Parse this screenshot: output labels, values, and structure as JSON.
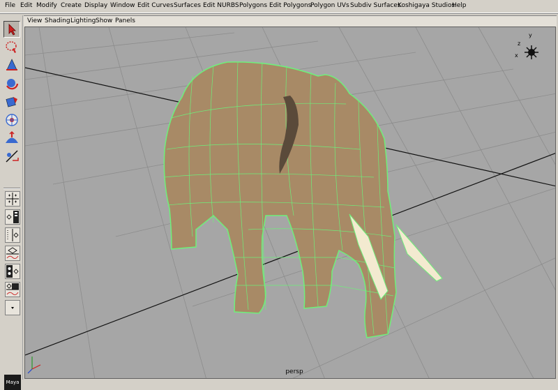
{
  "menubar": {
    "items": [
      {
        "label": "File"
      },
      {
        "label": "Edit"
      },
      {
        "label": "Modify"
      },
      {
        "label": "Create"
      },
      {
        "label": "Display"
      },
      {
        "label": "Window"
      },
      {
        "label": "Edit Curves"
      },
      {
        "label": "Surfaces"
      },
      {
        "label": "Edit NURBS"
      },
      {
        "label": "Polygons"
      },
      {
        "label": "Edit Polygons"
      },
      {
        "label": "Polygon UVs"
      },
      {
        "label": "Subdiv Surfaces"
      },
      {
        "label": "Koshigaya Studios"
      },
      {
        "label": "Help"
      }
    ]
  },
  "panel_menu": {
    "items": [
      {
        "label": "View"
      },
      {
        "label": "Shading"
      },
      {
        "label": "Lighting"
      },
      {
        "label": "Show"
      },
      {
        "label": "Panels"
      }
    ]
  },
  "viewport": {
    "camera_label": "persp",
    "axis": {
      "y": "y",
      "z": "z",
      "x": "x"
    },
    "background_color": "#a6a6a6",
    "wireframe_color": "#6ef07a",
    "grid_color": "#8a8a8a"
  },
  "logo": {
    "text": "Maya"
  },
  "colors": {
    "ui_gray": "#d4d0c8",
    "accent_select": "#cc2222"
  }
}
